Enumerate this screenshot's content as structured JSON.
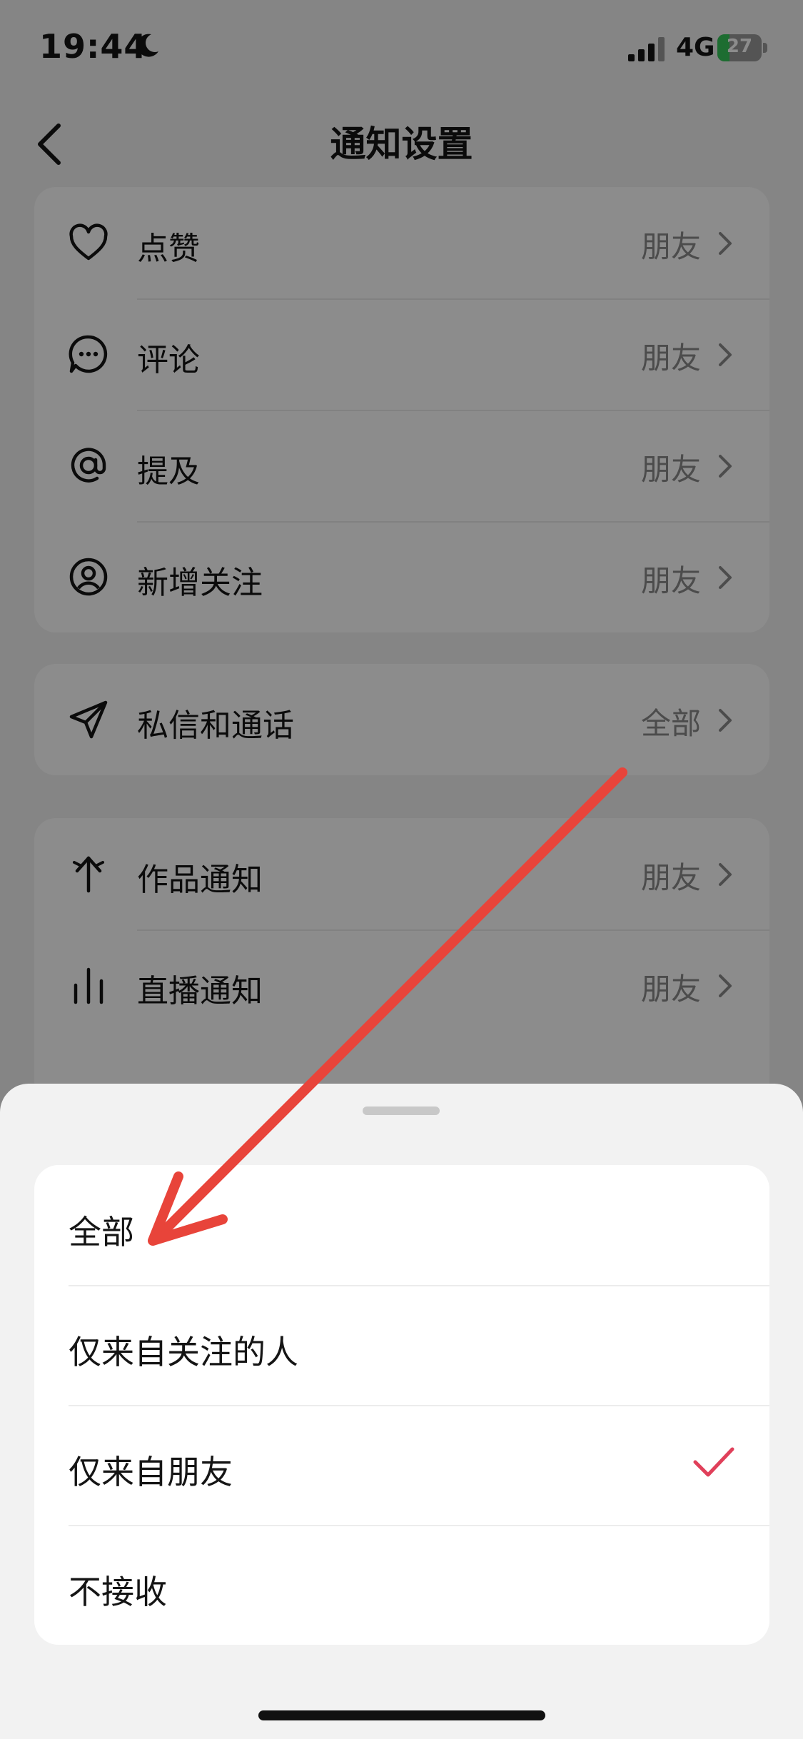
{
  "status_bar": {
    "time": "19:44",
    "network": "4G",
    "battery": "27",
    "battery_level": 0.27
  },
  "nav": {
    "title": "通知设置"
  },
  "group1": [
    {
      "icon": "heart-icon",
      "label": "点赞",
      "value": "朋友"
    },
    {
      "icon": "comment-bubble-icon",
      "label": "评论",
      "value": "朋友"
    },
    {
      "icon": "at-sign-icon",
      "label": "提及",
      "value": "朋友"
    },
    {
      "icon": "user-circle-icon",
      "label": "新增关注",
      "value": "朋友"
    }
  ],
  "group2": [
    {
      "icon": "paper-plane-icon",
      "label": "私信和通话",
      "value": "全部"
    }
  ],
  "group3": [
    {
      "icon": "sparkle-upload-icon",
      "label": "作品通知",
      "value": "朋友"
    },
    {
      "icon": "bar-chart-icon",
      "label": "直播通知",
      "value": "朋友"
    }
  ],
  "sheet": {
    "options": [
      {
        "label": "全部",
        "selected": false
      },
      {
        "label": "仅来自关注的人",
        "selected": false
      },
      {
        "label": "仅来自朋友",
        "selected": true
      },
      {
        "label": "不接收",
        "selected": false
      }
    ]
  },
  "colors": {
    "accent_check": "#e0405a",
    "annotation_arrow": "#e8443a"
  }
}
